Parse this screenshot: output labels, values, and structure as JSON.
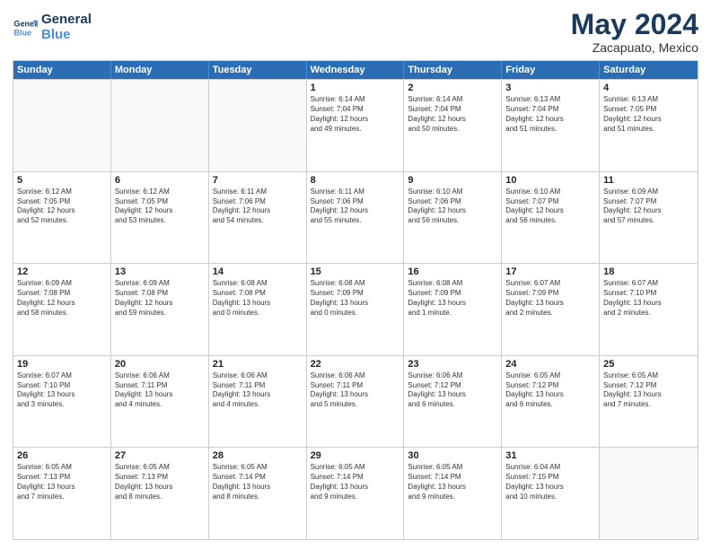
{
  "header": {
    "logo_line1": "General",
    "logo_line2": "Blue",
    "month": "May 2024",
    "location": "Zacapuato, Mexico"
  },
  "weekdays": [
    "Sunday",
    "Monday",
    "Tuesday",
    "Wednesday",
    "Thursday",
    "Friday",
    "Saturday"
  ],
  "rows": [
    [
      {
        "day": "",
        "text": ""
      },
      {
        "day": "",
        "text": ""
      },
      {
        "day": "",
        "text": ""
      },
      {
        "day": "1",
        "text": "Sunrise: 6:14 AM\nSunset: 7:04 PM\nDaylight: 12 hours\nand 49 minutes."
      },
      {
        "day": "2",
        "text": "Sunrise: 6:14 AM\nSunset: 7:04 PM\nDaylight: 12 hours\nand 50 minutes."
      },
      {
        "day": "3",
        "text": "Sunrise: 6:13 AM\nSunset: 7:04 PM\nDaylight: 12 hours\nand 51 minutes."
      },
      {
        "day": "4",
        "text": "Sunrise: 6:13 AM\nSunset: 7:05 PM\nDaylight: 12 hours\nand 51 minutes."
      }
    ],
    [
      {
        "day": "5",
        "text": "Sunrise: 6:12 AM\nSunset: 7:05 PM\nDaylight: 12 hours\nand 52 minutes."
      },
      {
        "day": "6",
        "text": "Sunrise: 6:12 AM\nSunset: 7:05 PM\nDaylight: 12 hours\nand 53 minutes."
      },
      {
        "day": "7",
        "text": "Sunrise: 6:11 AM\nSunset: 7:06 PM\nDaylight: 12 hours\nand 54 minutes."
      },
      {
        "day": "8",
        "text": "Sunrise: 6:11 AM\nSunset: 7:06 PM\nDaylight: 12 hours\nand 55 minutes."
      },
      {
        "day": "9",
        "text": "Sunrise: 6:10 AM\nSunset: 7:06 PM\nDaylight: 12 hours\nand 56 minutes."
      },
      {
        "day": "10",
        "text": "Sunrise: 6:10 AM\nSunset: 7:07 PM\nDaylight: 12 hours\nand 56 minutes."
      },
      {
        "day": "11",
        "text": "Sunrise: 6:09 AM\nSunset: 7:07 PM\nDaylight: 12 hours\nand 57 minutes."
      }
    ],
    [
      {
        "day": "12",
        "text": "Sunrise: 6:09 AM\nSunset: 7:08 PM\nDaylight: 12 hours\nand 58 minutes."
      },
      {
        "day": "13",
        "text": "Sunrise: 6:09 AM\nSunset: 7:08 PM\nDaylight: 12 hours\nand 59 minutes."
      },
      {
        "day": "14",
        "text": "Sunrise: 6:08 AM\nSunset: 7:08 PM\nDaylight: 13 hours\nand 0 minutes."
      },
      {
        "day": "15",
        "text": "Sunrise: 6:08 AM\nSunset: 7:09 PM\nDaylight: 13 hours\nand 0 minutes."
      },
      {
        "day": "16",
        "text": "Sunrise: 6:08 AM\nSunset: 7:09 PM\nDaylight: 13 hours\nand 1 minute."
      },
      {
        "day": "17",
        "text": "Sunrise: 6:07 AM\nSunset: 7:09 PM\nDaylight: 13 hours\nand 2 minutes."
      },
      {
        "day": "18",
        "text": "Sunrise: 6:07 AM\nSunset: 7:10 PM\nDaylight: 13 hours\nand 2 minutes."
      }
    ],
    [
      {
        "day": "19",
        "text": "Sunrise: 6:07 AM\nSunset: 7:10 PM\nDaylight: 13 hours\nand 3 minutes."
      },
      {
        "day": "20",
        "text": "Sunrise: 6:06 AM\nSunset: 7:11 PM\nDaylight: 13 hours\nand 4 minutes."
      },
      {
        "day": "21",
        "text": "Sunrise: 6:06 AM\nSunset: 7:11 PM\nDaylight: 13 hours\nand 4 minutes."
      },
      {
        "day": "22",
        "text": "Sunrise: 6:06 AM\nSunset: 7:11 PM\nDaylight: 13 hours\nand 5 minutes."
      },
      {
        "day": "23",
        "text": "Sunrise: 6:06 AM\nSunset: 7:12 PM\nDaylight: 13 hours\nand 6 minutes."
      },
      {
        "day": "24",
        "text": "Sunrise: 6:05 AM\nSunset: 7:12 PM\nDaylight: 13 hours\nand 6 minutes."
      },
      {
        "day": "25",
        "text": "Sunrise: 6:05 AM\nSunset: 7:12 PM\nDaylight: 13 hours\nand 7 minutes."
      }
    ],
    [
      {
        "day": "26",
        "text": "Sunrise: 6:05 AM\nSunset: 7:13 PM\nDaylight: 13 hours\nand 7 minutes."
      },
      {
        "day": "27",
        "text": "Sunrise: 6:05 AM\nSunset: 7:13 PM\nDaylight: 13 hours\nand 8 minutes."
      },
      {
        "day": "28",
        "text": "Sunrise: 6:05 AM\nSunset: 7:14 PM\nDaylight: 13 hours\nand 8 minutes."
      },
      {
        "day": "29",
        "text": "Sunrise: 6:05 AM\nSunset: 7:14 PM\nDaylight: 13 hours\nand 9 minutes."
      },
      {
        "day": "30",
        "text": "Sunrise: 6:05 AM\nSunset: 7:14 PM\nDaylight: 13 hours\nand 9 minutes."
      },
      {
        "day": "31",
        "text": "Sunrise: 6:04 AM\nSunset: 7:15 PM\nDaylight: 13 hours\nand 10 minutes."
      },
      {
        "day": "",
        "text": ""
      }
    ]
  ]
}
